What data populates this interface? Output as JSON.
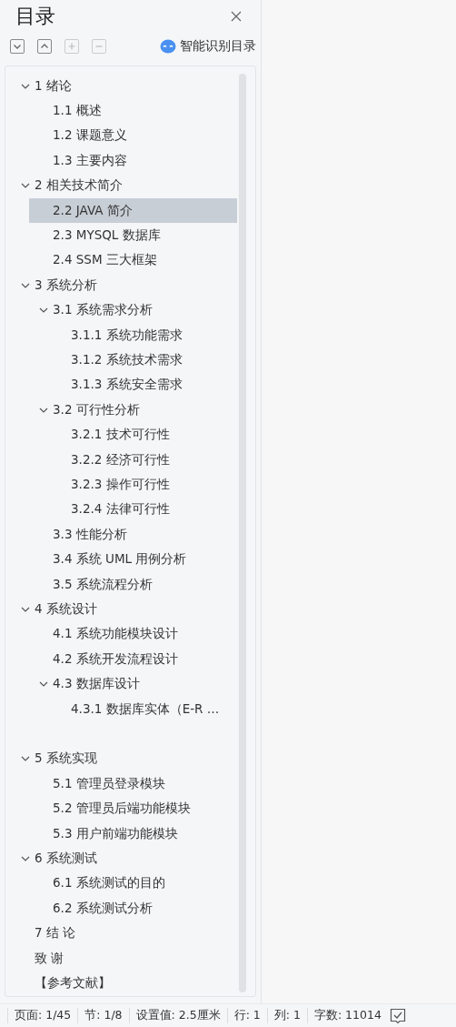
{
  "panel": {
    "title": "目录",
    "smart_button": "智能识别目录"
  },
  "tree": [
    {
      "label": "1 绪论",
      "expanded": true,
      "selected": false,
      "children": [
        {
          "label": "1.1 概述",
          "selected": false
        },
        {
          "label": "1.2 课题意义",
          "selected": false
        },
        {
          "label": "1.3 主要内容",
          "selected": false
        }
      ]
    },
    {
      "label": "2  相关技术简介",
      "expanded": true,
      "selected": false,
      "children": [
        {
          "label": "2.2 JAVA 简介",
          "selected": true
        },
        {
          "label": "2.3 MYSQL 数据库",
          "selected": false
        },
        {
          "label": "2.4 SSM 三大框架",
          "selected": false
        }
      ]
    },
    {
      "label": "3  系统分析",
      "expanded": true,
      "selected": false,
      "children": [
        {
          "label": "3.1  系统需求分析",
          "expanded": true,
          "selected": false,
          "children": [
            {
              "label": "3.1.1 系统功能需求",
              "selected": false
            },
            {
              "label": "3.1.2 系统技术需求",
              "selected": false
            },
            {
              "label": "3.1.3 系统安全需求",
              "selected": false
            }
          ]
        },
        {
          "label": "3.2  可行性分析",
          "expanded": true,
          "selected": false,
          "children": [
            {
              "label": "3.2.1 技术可行性",
              "selected": false
            },
            {
              "label": "3.2.2 经济可行性",
              "selected": false
            },
            {
              "label": "3.2.3 操作可行性",
              "selected": false
            },
            {
              "label": "3.2.4 法律可行性",
              "selected": false
            }
          ]
        },
        {
          "label": "3.3 性能分析",
          "selected": false
        },
        {
          "label": "3.4  系统 UML 用例分析",
          "selected": false
        },
        {
          "label": "3.5  系统流程分析",
          "selected": false
        }
      ]
    },
    {
      "label": "4  系统设计",
      "expanded": true,
      "selected": false,
      "children": [
        {
          "label": "4.1 系统功能模块设计",
          "selected": false
        },
        {
          "label": "4.2  系统开发流程设计",
          "selected": false
        },
        {
          "label": "4.3  数据库设计",
          "expanded": true,
          "selected": false,
          "children": [
            {
              "label": "4.3.1 数据库实体（E-R …",
              "kind": "truncated",
              "selected": false
            }
          ]
        }
      ]
    },
    {
      "label": "5  系统实现",
      "expanded": true,
      "selected": false,
      "children": [
        {
          "label": "5.1 管理员登录模块",
          "selected": false
        },
        {
          "label": "5.2 管理员后端功能模块",
          "selected": false
        },
        {
          "label": "5.3 用户前端功能模块",
          "selected": false
        }
      ]
    },
    {
      "label": "6  系统测试",
      "expanded": true,
      "selected": false,
      "children": [
        {
          "label": "6.1 系统测试的目的",
          "selected": false
        },
        {
          "label": "6.2 系统测试分析",
          "selected": false
        }
      ]
    },
    {
      "label": "7 结  论",
      "selected": false
    },
    {
      "label": "致  谢",
      "selected": false
    },
    {
      "label": "【参考文献】",
      "selected": false
    }
  ],
  "status_bar": [
    "页面: 1/45",
    "节: 1/8",
    "设置值: 2.5厘米",
    "行: 1",
    "列: 1",
    "字数: 11014"
  ]
}
